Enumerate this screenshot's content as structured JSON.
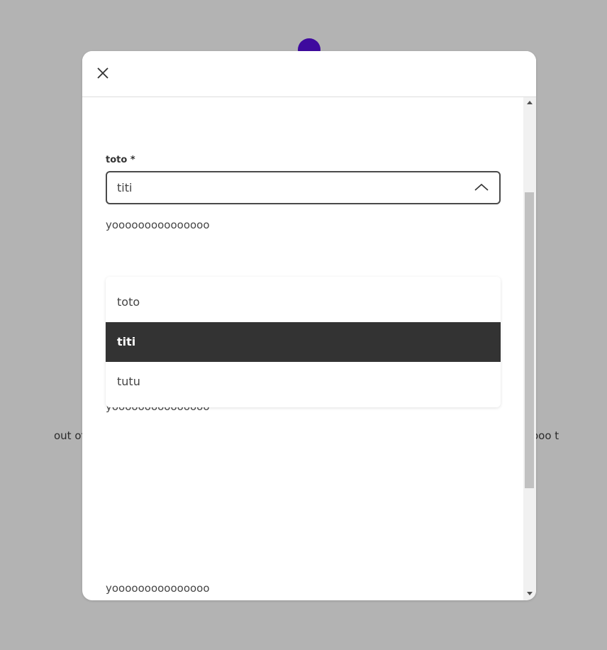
{
  "background": {
    "left_text": "out of",
    "right_text": "ooo t",
    "circle_color": "#3e0a9e"
  },
  "modal": {
    "close_icon": "close-icon",
    "field": {
      "label": "toto *",
      "value": "titi",
      "chevron_icon": "chevron-up-icon"
    },
    "helper_texts": [
      "yooooooooooooooo",
      "yooooooooooooooo",
      "yooooooooooooooo"
    ],
    "dropdown": {
      "options": [
        {
          "label": "toto",
          "selected": false
        },
        {
          "label": "titi",
          "selected": true
        },
        {
          "label": "tutu",
          "selected": false
        }
      ]
    }
  }
}
